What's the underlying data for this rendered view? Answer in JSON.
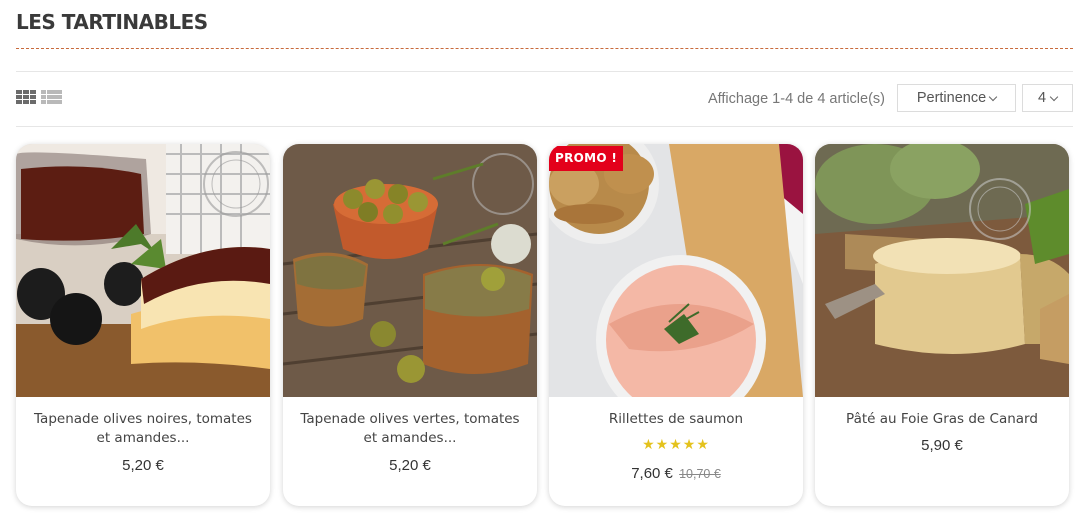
{
  "header": {
    "title": "LES TARTINABLES"
  },
  "toolbar": {
    "view_grid_icon": "grid-view-icon",
    "view_list_icon": "list-view-icon",
    "result_count": "Affichage 1-4 de 4 article(s)",
    "sort_selected": "Pertinence",
    "per_page_selected": "4"
  },
  "products": [
    {
      "name": "Tapenade olives noires, tomates et amandes...",
      "price": "5,20 €"
    },
    {
      "name": "Tapenade olives vertes, tomates et amandes...",
      "price": "5,20 €"
    },
    {
      "name": "Rillettes de saumon",
      "price": "7,60 €",
      "old_price": "10,70 €",
      "badge": "PROMO !",
      "rating": "★★★★★"
    },
    {
      "name": "Pâté au Foie Gras de Canard",
      "price": "5,90 €"
    }
  ],
  "colors": {
    "accent": "#c86a3c",
    "promo": "#e3001b",
    "stars": "#e4c21d"
  }
}
